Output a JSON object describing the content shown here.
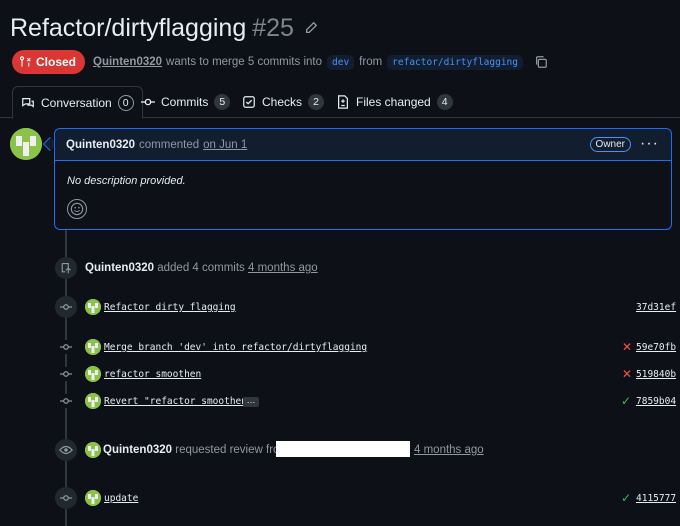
{
  "pr": {
    "title": "Refactor/dirtyflagging",
    "number": "#25",
    "state": "Closed",
    "author": "Quinten0320",
    "merge_text": "wants to merge 5 commits into",
    "base_branch": "dev",
    "from_text": "from",
    "head_branch": "refactor/dirtyflagging"
  },
  "tabs": [
    {
      "label": "Conversation",
      "count": "0"
    },
    {
      "label": "Commits",
      "count": "5"
    },
    {
      "label": "Checks",
      "count": "2"
    },
    {
      "label": "Files changed",
      "count": "4"
    }
  ],
  "comment": {
    "author": "Quinten0320",
    "verb": "commented",
    "date": "on Jun 1",
    "badge": "Owner",
    "body": "No description provided."
  },
  "events": {
    "added": {
      "who": "Quinten0320",
      "text": "added 4 commits",
      "when": "4 months ago"
    },
    "review": {
      "who": "Quinten0320",
      "text": "requested review from",
      "when": "4 months ago"
    }
  },
  "commits": [
    {
      "message": "Refactor dirty flagging",
      "sha": "37d31ef",
      "status": "none"
    },
    {
      "message": "Merge branch 'dev' into refactor/dirtyflagging",
      "sha": "59e70fb",
      "status": "fail"
    },
    {
      "message": "refactor smoothen",
      "sha": "519840b",
      "status": "fail"
    },
    {
      "message": "Revert \"refactor smoothen\"",
      "sha": "7859b04",
      "status": "ok"
    },
    {
      "message": "update",
      "sha": "4115777",
      "status": "ok"
    }
  ],
  "icons": {
    "fail": "✕",
    "ok": "✓",
    "ellipsis": "…"
  },
  "colors": {
    "closed": "#da3633",
    "accent": "#4493f8",
    "success": "#3fb950",
    "danger": "#f85149"
  }
}
